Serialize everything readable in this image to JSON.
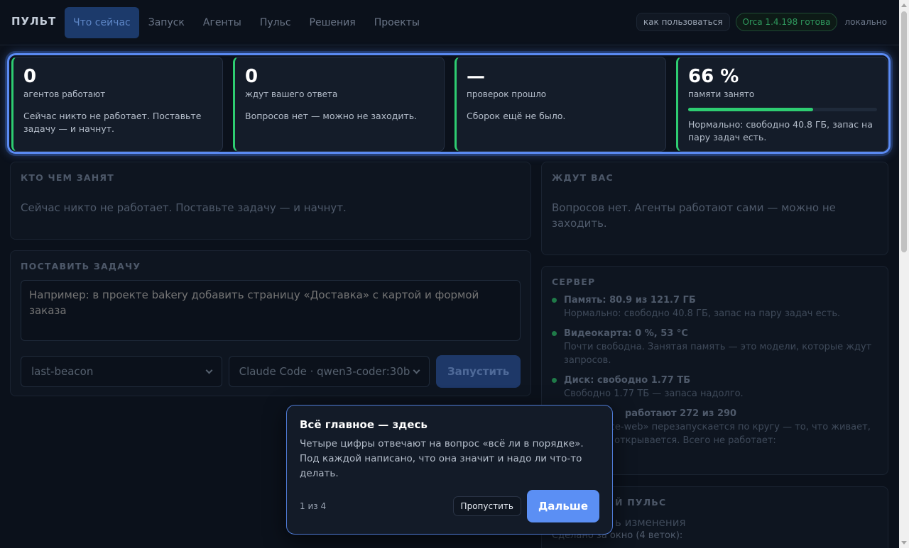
{
  "brand": "ПУЛЬТ",
  "nav": [
    {
      "label": "Что сейчас",
      "active": true
    },
    {
      "label": "Запуск"
    },
    {
      "label": "Агенты"
    },
    {
      "label": "Пульс"
    },
    {
      "label": "Решения"
    },
    {
      "label": "Проекты"
    }
  ],
  "topright": {
    "help": "как пользоваться",
    "status": "Orca 1.4.198 готова",
    "mode": "локально"
  },
  "stats": [
    {
      "value": "0",
      "label": "агентов работают",
      "desc": "Сейчас никто не работает. Поставьте задачу — и начнут."
    },
    {
      "value": "0",
      "label": "ждут вашего ответа",
      "desc": "Вопросов нет — можно не заходить."
    },
    {
      "value": "—",
      "label": "проверок прошло",
      "desc": "Сборок ещё не было."
    },
    {
      "value": "66 %",
      "label": "памяти занято",
      "desc": "Нормально: свободно 40.8 ГБ, запас на пару задач есть.",
      "progress": 0.66
    }
  ],
  "busy": {
    "title": "КТО ЧЕМ ЗАНЯТ",
    "text": "Сейчас никто не работает. Поставьте задачу — и начнут."
  },
  "waiting": {
    "title": "ЖДУТ ВАС",
    "text": "Вопросов нет. Агенты работают сами — можно не заходить."
  },
  "task": {
    "title": "ПОСТАВИТЬ ЗАДАЧУ",
    "placeholder": "Например: в проекте bakery добавить страницу «Доставка» с картой и формой заказа",
    "project": "last-beacon",
    "engine": "Claude Code · qwen3-coder:30b",
    "launch": "Запустить"
  },
  "server": {
    "title": "СЕРВЕР",
    "items": [
      {
        "title": "Память: 80.9 из 121.7 ГБ",
        "desc": "Нормально: свободно 40.8 ГБ, запас на пару задач есть."
      },
      {
        "title": "Видеокарта: 0 %, 53 °C",
        "desc": "Почти свободна. Занятая память — это модели, которые ждут запросов."
      },
      {
        "title": "Диск: свободно 1.77 ТБ",
        "desc": "Свободно 1.77 ТБ — запаса надолго."
      },
      {
        "title": "работают 272 из 290",
        "desc": "g-rznservice-web» перезапускается по кругу — то, что живает, сейчас не открывается. Всего не работает:"
      }
    ]
  },
  "pulse": {
    "title": "Й ПУЛЬС",
    "line1": "ь изменения",
    "line2": "Сделано за окно (4 веток):"
  },
  "tour": {
    "title": "Всё главное — здесь",
    "body": "Четыре цифры отвечают на вопрос «всё ли в порядке». Под каждой написано, что она значит и надо ли что-то делать.",
    "step": "1 из 4",
    "skip": "Пропустить",
    "next": "Дальше"
  },
  "colors": {
    "accent": "#5b8ff4",
    "ok": "#2ecc71",
    "background": "#0b111b"
  }
}
